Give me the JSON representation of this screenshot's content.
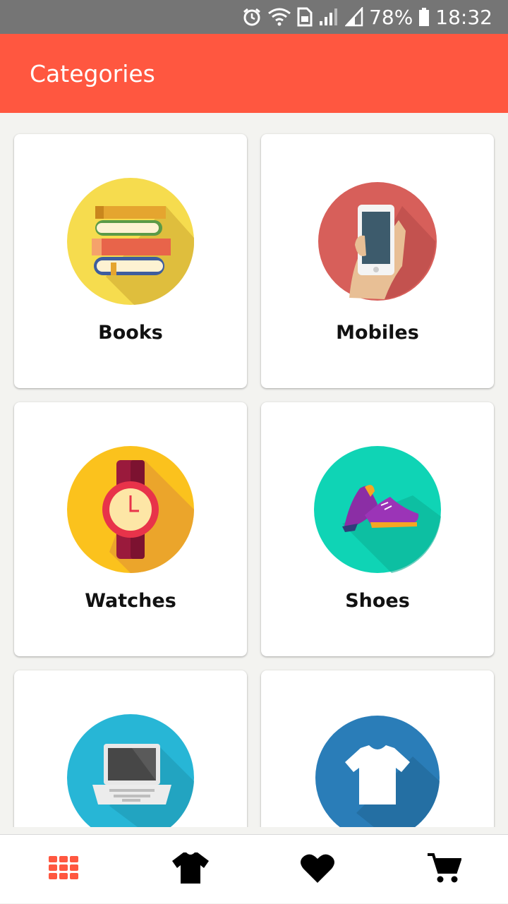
{
  "status_bar": {
    "battery": "78%",
    "time": "18:32",
    "icons": [
      "alarm-icon",
      "wifi-icon",
      "sim-icon",
      "signal-icon",
      "signal-icon",
      "battery-icon"
    ]
  },
  "app_bar": {
    "title": "Categories",
    "color": "#ff5740"
  },
  "categories": [
    {
      "label": "Books",
      "icon": "books-icon"
    },
    {
      "label": "Mobiles",
      "icon": "mobile-phone-icon"
    },
    {
      "label": "Watches",
      "icon": "watch-icon"
    },
    {
      "label": "Shoes",
      "icon": "shoes-icon"
    },
    {
      "label": "",
      "icon": "laptop-icon"
    },
    {
      "label": "",
      "icon": "tshirt-icon"
    }
  ],
  "bottom_nav": {
    "active_color": "#ff5740",
    "items": [
      {
        "icon": "grid-icon",
        "active": true
      },
      {
        "icon": "tshirt-icon",
        "active": false
      },
      {
        "icon": "heart-icon",
        "active": false
      },
      {
        "icon": "cart-icon",
        "active": false
      }
    ]
  }
}
